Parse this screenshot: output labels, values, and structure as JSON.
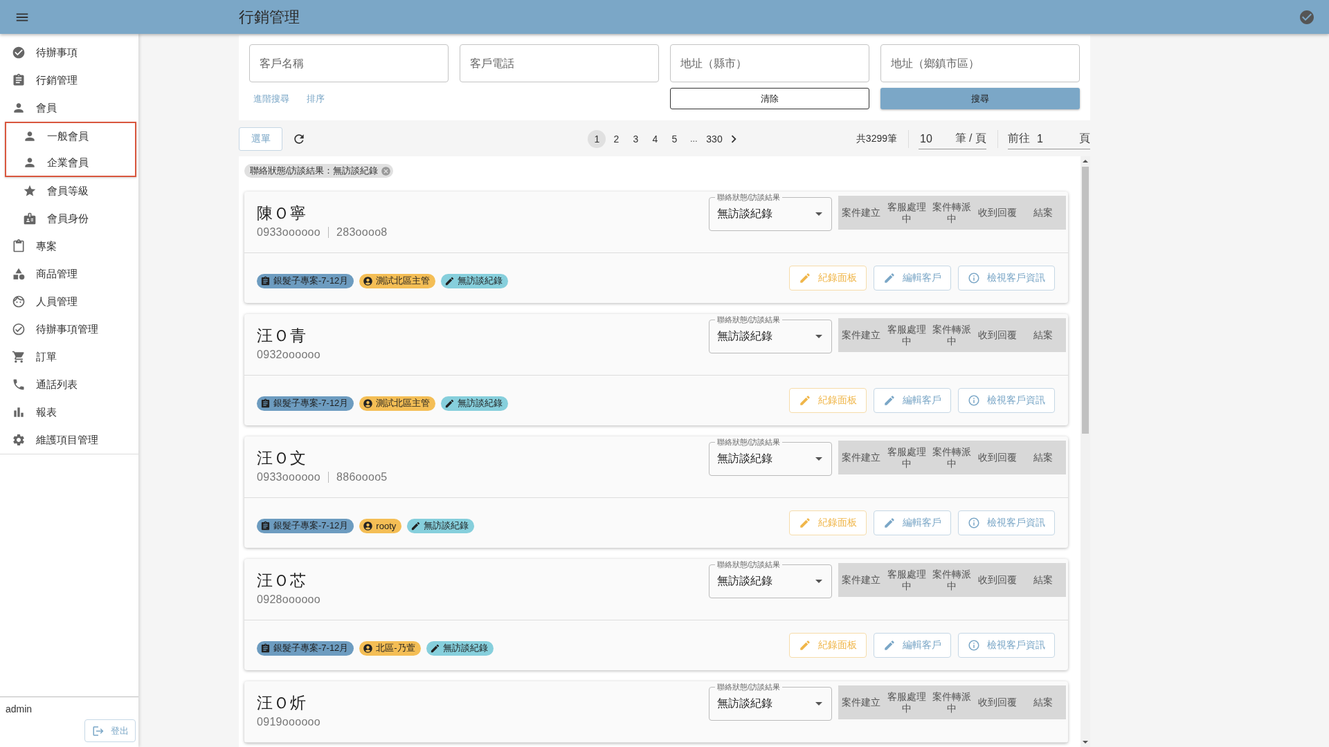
{
  "header": {
    "title": "行銷管理"
  },
  "sidebar": {
    "items": [
      {
        "label": "待辦事項"
      },
      {
        "label": "行銷管理"
      },
      {
        "label": "會員",
        "children": [
          {
            "label": "一般會員",
            "highlighted": true
          },
          {
            "label": "企業會員",
            "highlighted": true
          },
          {
            "label": "會員等級",
            "highlighted": false
          },
          {
            "label": "會員身份",
            "highlighted": false
          }
        ]
      },
      {
        "label": "專案"
      },
      {
        "label": "商品管理"
      },
      {
        "label": "人員管理"
      },
      {
        "label": "待辦事項管理"
      },
      {
        "label": "訂單"
      },
      {
        "label": "通話列表"
      },
      {
        "label": "報表"
      },
      {
        "label": "維護項目管理"
      }
    ],
    "user": "admin",
    "logout_button": "登出"
  },
  "search": {
    "fields": [
      {
        "placeholder": "客戶名稱"
      },
      {
        "placeholder": "客戶電話"
      },
      {
        "placeholder": "地址（縣市）"
      },
      {
        "placeholder": "地址（鄉鎮市區）"
      }
    ],
    "links": [
      "進階搜尋",
      "排序"
    ],
    "clear_button": "清除",
    "search_button": "搜尋"
  },
  "toolbar": {
    "menu_button": "選單",
    "pages": [
      {
        "kind": "page",
        "label": "1",
        "selected": true
      },
      {
        "kind": "page",
        "label": "2",
        "selected": false
      },
      {
        "kind": "page",
        "label": "3",
        "selected": false
      },
      {
        "kind": "page",
        "label": "4",
        "selected": false
      },
      {
        "kind": "page",
        "label": "5",
        "selected": false
      },
      {
        "kind": "ellipsis",
        "label": "...",
        "selected": false
      },
      {
        "kind": "page",
        "label": "330",
        "selected": false
      }
    ],
    "total": "共3299筆",
    "page_size": {
      "value": "10",
      "unit": "筆 / 頁"
    },
    "goto": {
      "prefix": "前往",
      "value": "1",
      "suffix": "頁"
    }
  },
  "filters": [
    {
      "label": "聯絡狀態/訪談結果：無訪談紀錄"
    }
  ],
  "customers": [
    {
      "name": "陳Ｏ寧",
      "phones": [
        "0933oooooo",
        "283oooo8"
      ],
      "status": {
        "label": "聯絡狀態/訪談結果",
        "value": "無訪談紀錄"
      },
      "steps": [
        "案件建立",
        "客服處理中",
        "案件轉派中",
        "收到回覆",
        "結案"
      ],
      "tags": [
        {
          "kind": "project",
          "label": "銀髮子專案-7-12月",
          "color": "#6d9cc0"
        },
        {
          "kind": "owner",
          "label": "測試北區主管",
          "color": "#f4be55"
        },
        {
          "kind": "status",
          "label": "無訪談紀錄",
          "color": "#86cfdc"
        }
      ],
      "actions": [
        {
          "kind": "record",
          "label": "紀錄面板"
        },
        {
          "kind": "edit",
          "label": "編輯客戶"
        },
        {
          "kind": "view",
          "label": "檢視客戶資訊"
        }
      ]
    },
    {
      "name": "汪Ｏ青",
      "phones": [
        "0932oooooo"
      ],
      "status": {
        "label": "聯絡狀態/訪談結果",
        "value": "無訪談紀錄"
      },
      "steps": [
        "案件建立",
        "客服處理中",
        "案件轉派中",
        "收到回覆",
        "結案"
      ],
      "tags": [
        {
          "kind": "project",
          "label": "銀髮子專案-7-12月",
          "color": "#6d9cc0"
        },
        {
          "kind": "owner",
          "label": "測試北區主管",
          "color": "#f4be55"
        },
        {
          "kind": "status",
          "label": "無訪談紀錄",
          "color": "#86cfdc"
        }
      ],
      "actions": [
        {
          "kind": "record",
          "label": "紀錄面板"
        },
        {
          "kind": "edit",
          "label": "編輯客戶"
        },
        {
          "kind": "view",
          "label": "檢視客戶資訊"
        }
      ]
    },
    {
      "name": "汪Ｏ文",
      "phones": [
        "0933oooooo",
        "886oooo5"
      ],
      "status": {
        "label": "聯絡狀態/訪談結果",
        "value": "無訪談紀錄"
      },
      "steps": [
        "案件建立",
        "客服處理中",
        "案件轉派中",
        "收到回覆",
        "結案"
      ],
      "tags": [
        {
          "kind": "project",
          "label": "銀髮子專案-7-12月",
          "color": "#6d9cc0"
        },
        {
          "kind": "owner",
          "label": "rooty",
          "color": "#f4be55"
        },
        {
          "kind": "status",
          "label": "無訪談紀錄",
          "color": "#86cfdc"
        }
      ],
      "actions": [
        {
          "kind": "record",
          "label": "紀錄面板"
        },
        {
          "kind": "edit",
          "label": "編輯客戶"
        },
        {
          "kind": "view",
          "label": "檢視客戶資訊"
        }
      ]
    },
    {
      "name": "汪Ｏ芯",
      "phones": [
        "0928oooooo"
      ],
      "status": {
        "label": "聯絡狀態/訪談結果",
        "value": "無訪談紀錄"
      },
      "steps": [
        "案件建立",
        "客服處理中",
        "案件轉派中",
        "收到回覆",
        "結案"
      ],
      "tags": [
        {
          "kind": "project",
          "label": "銀髮子專案-7-12月",
          "color": "#6d9cc0"
        },
        {
          "kind": "owner",
          "label": "北區-乃萱",
          "color": "#f4be55"
        },
        {
          "kind": "status",
          "label": "無訪談紀錄",
          "color": "#86cfdc"
        }
      ],
      "actions": [
        {
          "kind": "record",
          "label": "紀錄面板"
        },
        {
          "kind": "edit",
          "label": "編輯客戶"
        },
        {
          "kind": "view",
          "label": "檢視客戶資訊"
        }
      ]
    },
    {
      "name": "汪Ｏ炘",
      "phones": [
        "0919oooooo"
      ],
      "status": {
        "label": "聯絡狀態/訪談結果",
        "value": "無訪談紀錄"
      },
      "steps": [
        "案件建立",
        "客服處理中",
        "案件轉派中",
        "收到回覆",
        "結案"
      ]
    }
  ]
}
